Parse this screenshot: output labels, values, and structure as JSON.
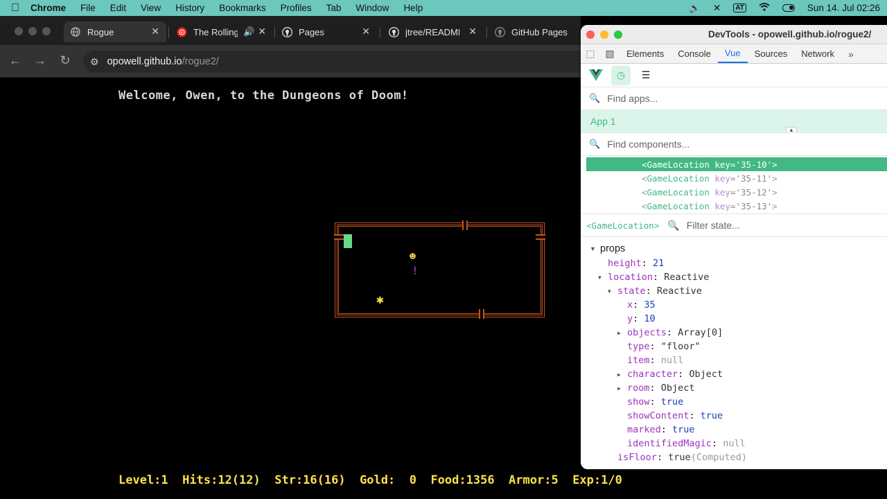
{
  "menubar": {
    "app": "Chrome",
    "items": [
      "File",
      "Edit",
      "View",
      "History",
      "Bookmarks",
      "Profiles",
      "Tab",
      "Window",
      "Help"
    ],
    "input_source": "AT",
    "datetime": "Sun 14. Jul  02:26"
  },
  "browser": {
    "tabs": [
      {
        "title": "Rogue",
        "icon": "globe-icon"
      },
      {
        "title": "The Rolling",
        "icon": "youtube-music-icon"
      },
      {
        "title": "Pages",
        "icon": "github-icon"
      },
      {
        "title": "jtree/README",
        "icon": "github-icon"
      },
      {
        "title": "GitHub Pages",
        "icon": "github-icon"
      }
    ],
    "url_host": "opowell.github.io",
    "url_path": "/rogue2/"
  },
  "game": {
    "welcome": "Welcome, Owen, to the Dungeons of Doom!",
    "status": {
      "level": "Level:1",
      "hits": "Hits:12(12)",
      "str": "Str:16(16)",
      "gold": "Gold:  0",
      "food": "Food:1356",
      "armor": "Armor:5",
      "exp": "Exp:1/0"
    },
    "colors": {
      "wall": "#c9541a",
      "floor": "#3ec33e",
      "player": "#67d78a",
      "item": "#ffe14a",
      "potion": "#8e2aa8"
    }
  },
  "devtools": {
    "title": "DevTools - opowell.github.io/rogue2/",
    "tabs": [
      "Elements",
      "Console",
      "Vue",
      "Sources",
      "Network"
    ],
    "active_tab": "Vue",
    "find_apps_placeholder": "Find apps...",
    "app_name": "App 1",
    "find_components_placeholder": "Find components...",
    "components": [
      {
        "name": "GameLocation",
        "key": "'35-10'",
        "selected": true
      },
      {
        "name": "GameLocation",
        "key": "'35-11'",
        "selected": false
      },
      {
        "name": "GameLocation",
        "key": "'35-12'",
        "selected": false
      },
      {
        "name": "GameLocation",
        "key": "'35-13'",
        "selected": false
      }
    ],
    "selected_component": "<GameLocation>",
    "filter_state_placeholder": "Filter state...",
    "props_label": "props",
    "props": {
      "height": "21",
      "location": "Reactive",
      "state": "Reactive",
      "x": "35",
      "y": "10",
      "objects": "Array[0]",
      "type": "\"floor\"",
      "item": "null",
      "character": "Object",
      "room": "Object",
      "show": "true",
      "showContent": "true",
      "marked": "true",
      "identifiedMagic": "null",
      "isFloor": "true",
      "isFloor_note": "(Computed)"
    }
  }
}
